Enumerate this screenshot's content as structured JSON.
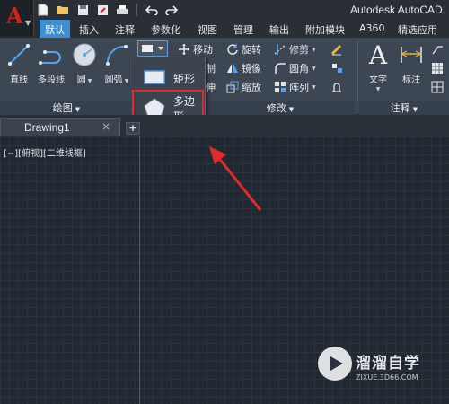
{
  "app": {
    "logo_letter": "A",
    "title": "Autodesk AutoCAD"
  },
  "ribbon_tabs": [
    "默认",
    "插入",
    "注释",
    "参数化",
    "视图",
    "管理",
    "输出",
    "附加模块",
    "A360",
    "精选应用"
  ],
  "panels": {
    "draw": {
      "footer": "绘图",
      "tools": [
        "直线",
        "多段线",
        "圆",
        "圆弧"
      ]
    },
    "modify": {
      "footer": "修改",
      "tools": [
        "移动",
        "旋转",
        "修剪",
        "镜像",
        "圆角",
        "缩放",
        "阵列"
      ],
      "partial_labels": [
        "制",
        "伸"
      ]
    },
    "annotation": {
      "footer": "注释",
      "tools": [
        "文字",
        "标注"
      ]
    }
  },
  "flyout": {
    "items": [
      "矩形",
      "多边形"
    ],
    "highlighted": "多边形"
  },
  "document": {
    "tab_label": "Drawing1",
    "close_glyph": "×",
    "new_tab_glyph": "+"
  },
  "viewport": {
    "label": "[−][俯视][二维线框]"
  },
  "watermark": {
    "title": "溜溜自学",
    "url": "ZIXUE.3D66.COM"
  },
  "colors": {
    "canvas_bg": "#212830",
    "ribbon_bg": "#3d4653",
    "active_tab": "#3c8fd2",
    "highlight_red": "#e12a2a",
    "brand_red": "#d11f1f",
    "icon_blue": "#5aa0e6",
    "y_axis_green": "#2f7a3e"
  }
}
